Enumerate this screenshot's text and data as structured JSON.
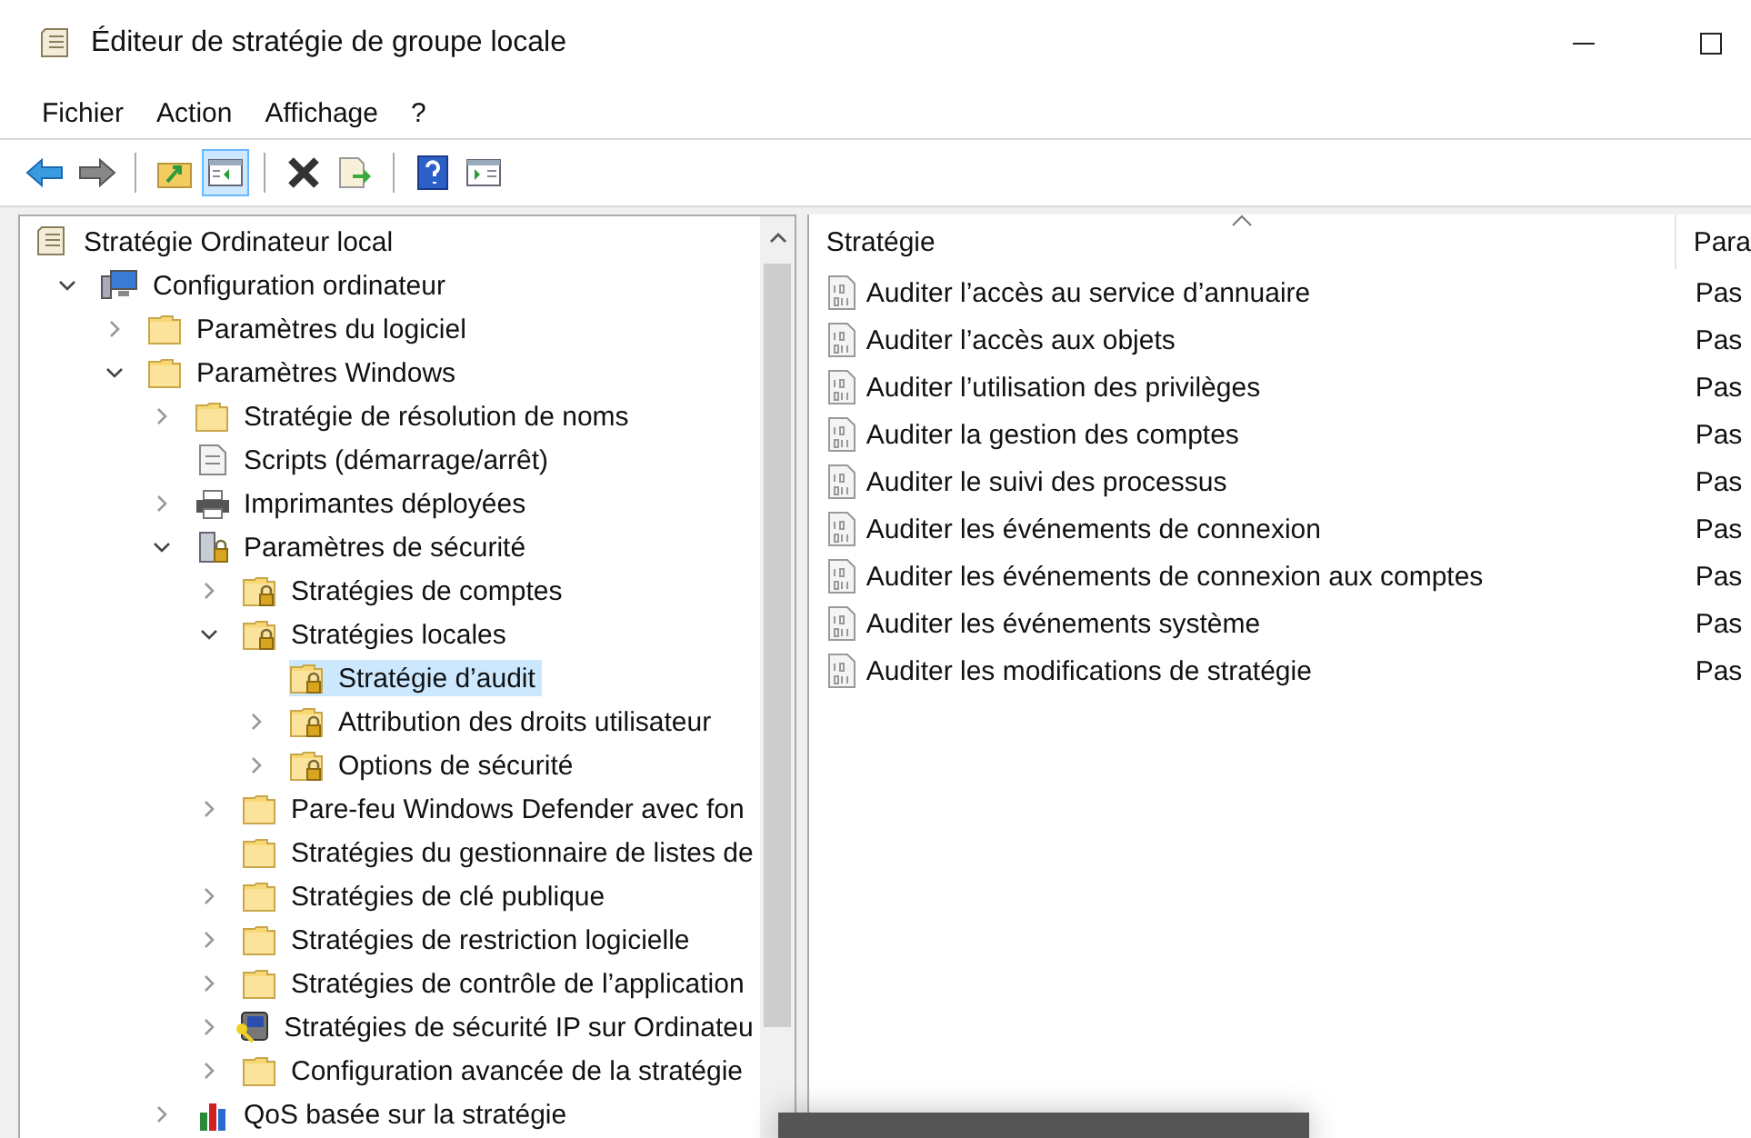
{
  "window": {
    "title": "Éditeur de stratégie de groupe locale"
  },
  "menu": [
    "Fichier",
    "Action",
    "Affichage",
    "?"
  ],
  "toolbar": [
    [
      {
        "kind": "back",
        "pressed": false
      },
      {
        "kind": "forward",
        "pressed": false
      }
    ],
    [
      {
        "kind": "up",
        "pressed": false
      },
      {
        "kind": "tree",
        "pressed": true
      }
    ],
    [
      {
        "kind": "delete",
        "pressed": false
      },
      {
        "kind": "export",
        "pressed": false
      }
    ],
    [
      {
        "kind": "help",
        "pressed": false
      },
      {
        "kind": "actionpane",
        "pressed": false
      }
    ]
  ],
  "tree": {
    "root": {
      "label": "Stratégie Ordinateur local",
      "kind": "policy",
      "selected": false
    },
    "items": [
      {
        "label": "Configuration ordinateur",
        "kind": "computer",
        "expanded": true,
        "selected": false,
        "children": [
          {
            "label": "Paramètres du logiciel",
            "kind": "folder",
            "expanded": false,
            "selected": false
          },
          {
            "label": "Paramètres Windows",
            "kind": "folder",
            "expanded": true,
            "selected": false,
            "children": [
              {
                "label": "Stratégie de résolution de noms",
                "kind": "folder",
                "expanded": false,
                "selected": false
              },
              {
                "label": "Scripts (démarrage/arrêt)",
                "kind": "scripts",
                "selected": false
              },
              {
                "label": "Imprimantes déployées",
                "kind": "printer",
                "expanded": false,
                "selected": false
              },
              {
                "label": "Paramètres de sécurité",
                "kind": "security",
                "expanded": true,
                "selected": false,
                "children": [
                  {
                    "label": "Stratégies de comptes",
                    "kind": "locked",
                    "expanded": false,
                    "selected": false
                  },
                  {
                    "label": "Stratégies locales",
                    "kind": "locked",
                    "expanded": true,
                    "selected": false,
                    "children": [
                      {
                        "label": "Stratégie d’audit",
                        "kind": "locked",
                        "selected": true
                      },
                      {
                        "label": "Attribution des droits utilisateur",
                        "kind": "locked",
                        "expanded": false,
                        "selected": false
                      },
                      {
                        "label": "Options de sécurité",
                        "kind": "locked",
                        "expanded": false,
                        "selected": false
                      }
                    ]
                  },
                  {
                    "label": "Pare-feu Windows Defender avec fon",
                    "kind": "folder",
                    "expanded": false,
                    "selected": false
                  },
                  {
                    "label": "Stratégies du gestionnaire de listes de",
                    "kind": "folder",
                    "selected": false
                  },
                  {
                    "label": "Stratégies de clé publique",
                    "kind": "folder",
                    "expanded": false,
                    "selected": false
                  },
                  {
                    "label": "Stratégies de restriction logicielle",
                    "kind": "folder",
                    "expanded": false,
                    "selected": false
                  },
                  {
                    "label": "Stratégies de contrôle de l’application",
                    "kind": "folder",
                    "expanded": false,
                    "selected": false
                  },
                  {
                    "label": "Stratégies de sécurité IP sur Ordinateu",
                    "kind": "ipsec",
                    "expanded": false,
                    "selected": false
                  },
                  {
                    "label": "Configuration avancée de la stratégie",
                    "kind": "folder",
                    "expanded": false,
                    "selected": false
                  }
                ]
              },
              {
                "label": "QoS basée sur la stratégie",
                "kind": "chart",
                "expanded": false,
                "selected": false
              }
            ]
          }
        ]
      }
    ]
  },
  "list": {
    "columns": [
      {
        "label": "Stratégie",
        "sorted": true
      },
      {
        "label": "Para",
        "sorted": false
      }
    ],
    "rows": [
      {
        "name": "Auditer l’accès au service d’annuaire",
        "setting": "Pas"
      },
      {
        "name": "Auditer l’accès aux objets",
        "setting": "Pas"
      },
      {
        "name": "Auditer l’utilisation des privilèges",
        "setting": "Pas"
      },
      {
        "name": "Auditer la gestion des comptes",
        "setting": "Pas"
      },
      {
        "name": "Auditer le suivi des processus",
        "setting": "Pas"
      },
      {
        "name": "Auditer les événements de connexion",
        "setting": "Pas"
      },
      {
        "name": "Auditer les événements de connexion aux comptes",
        "setting": "Pas"
      },
      {
        "name": "Auditer les événements système",
        "setting": "Pas"
      },
      {
        "name": "Auditer les modifications de stratégie",
        "setting": "Pas"
      }
    ]
  }
}
